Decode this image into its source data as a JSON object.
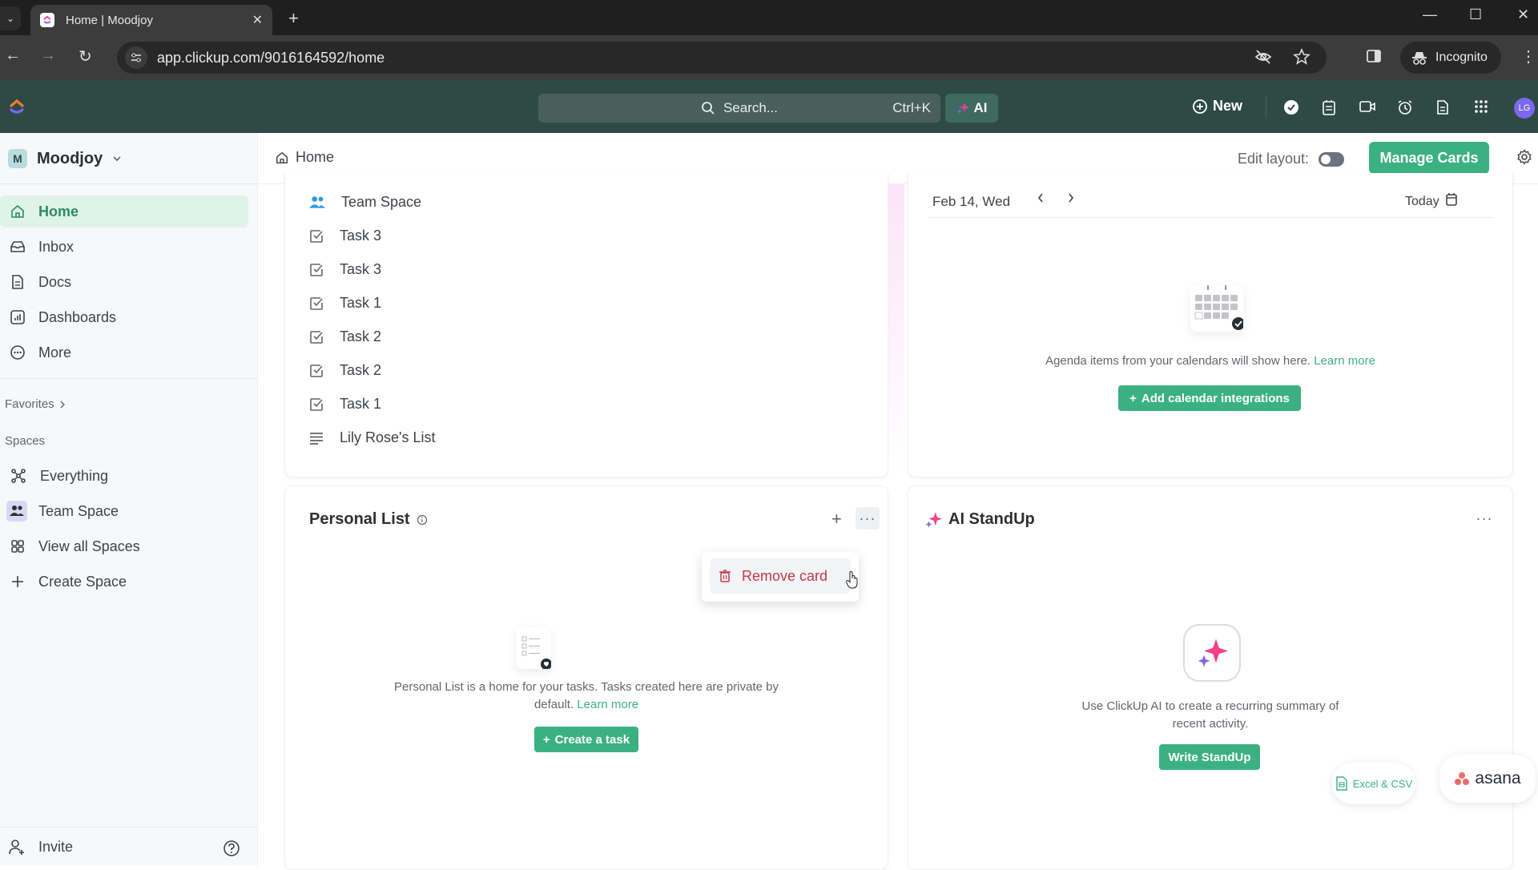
{
  "browser": {
    "tab_title": "Home | Moodjoy",
    "url": "app.clickup.com/9016164592/home",
    "incognito_label": "Incognito"
  },
  "topbar": {
    "search_placeholder": "Search...",
    "search_shortcut": "Ctrl+K",
    "ai_label": "AI",
    "new_label": "New",
    "avatar_initials": "LG"
  },
  "sidebar": {
    "workspace_initial": "M",
    "workspace_name": "Moodjoy",
    "nav": [
      {
        "label": "Home",
        "icon": "home-icon",
        "active": true
      },
      {
        "label": "Inbox",
        "icon": "inbox-icon"
      },
      {
        "label": "Docs",
        "icon": "doc-icon"
      },
      {
        "label": "Dashboards",
        "icon": "dashboard-icon"
      },
      {
        "label": "More",
        "icon": "more-icon"
      }
    ],
    "favorites_label": "Favorites",
    "spaces_label": "Spaces",
    "spaces": [
      {
        "label": "Everything",
        "icon": "everything-icon"
      },
      {
        "label": "Team Space",
        "icon": "team-icon"
      },
      {
        "label": "View all Spaces",
        "icon": "grid-icon"
      },
      {
        "label": "Create Space",
        "icon": "plus-icon"
      }
    ],
    "invite_label": "Invite"
  },
  "header": {
    "breadcrumb": "Home",
    "edit_layout_label": "Edit layout:",
    "edit_layout_on": false,
    "manage_cards_label": "Manage Cards"
  },
  "recents": {
    "items": [
      {
        "label": "Team Space",
        "type": "space"
      },
      {
        "label": "Task 3",
        "type": "task"
      },
      {
        "label": "Task 3",
        "type": "task"
      },
      {
        "label": "Task 1",
        "type": "task"
      },
      {
        "label": "Task 2",
        "type": "task"
      },
      {
        "label": "Task 2",
        "type": "task"
      },
      {
        "label": "Task 1",
        "type": "task"
      },
      {
        "label": "Lily Rose's List",
        "type": "list"
      }
    ]
  },
  "agenda": {
    "date": "Feb 14, Wed",
    "today_label": "Today",
    "empty_text": "Agenda items from your calendars will show here.",
    "learn_more": "Learn more",
    "add_button": "Add calendar integrations"
  },
  "personal_list": {
    "title": "Personal List",
    "menu_item": "Remove card",
    "empty_text_1": "Personal List is a home for your tasks. Tasks created here are private by",
    "empty_text_2": "default.",
    "learn_more": "Learn more",
    "create_button": "Create a task"
  },
  "ai_standup": {
    "title": "AI StandUp",
    "empty_text_1": "Use ClickUp AI to create a recurring summary of",
    "empty_text_2": "recent activity.",
    "button": "Write StandUp"
  },
  "import_chips": {
    "excel": "Excel & CSV",
    "asana": "asana"
  },
  "colors": {
    "brand_green": "#3bb181",
    "topbar": "#2f4a45",
    "danger": "#c0394b"
  }
}
